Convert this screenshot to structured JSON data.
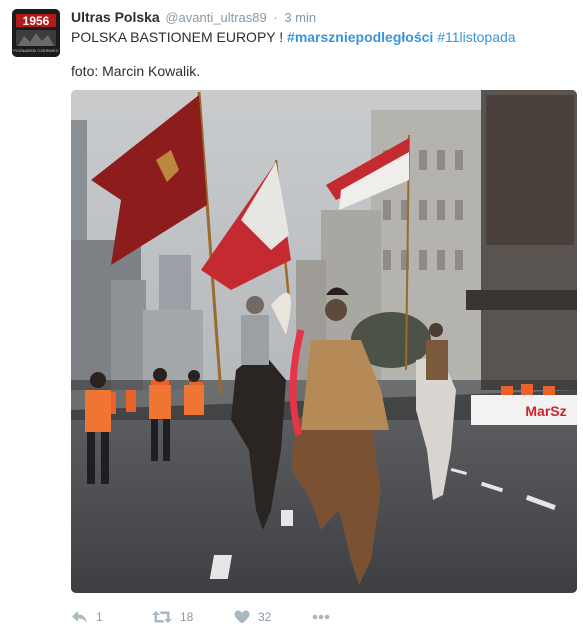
{
  "tweet": {
    "author": {
      "display_name": "Ultras Polska",
      "handle": "@avanti_ultras89",
      "avatar_label": "1956",
      "avatar_caption": "POZNAŃSKI CZERWIEC"
    },
    "separator": "·",
    "time": "3 min",
    "text": {
      "main": "POLSKA BASTIONEM EUROPY ! ",
      "hashtag_1": "#marszniepodległości",
      "hashtag_2": "#11listopada"
    },
    "credit": "foto: Marcin Kowalik.",
    "photo": {
      "description_icon": "photo-image",
      "banner_text": "MarSz"
    },
    "actions": {
      "reply_count": "1",
      "retweet_count": "18",
      "like_count": "32"
    }
  },
  "colors": {
    "link": "#3b94d9",
    "muted": "#8899a6",
    "icon": "#aab8c2",
    "text": "#292f33"
  }
}
